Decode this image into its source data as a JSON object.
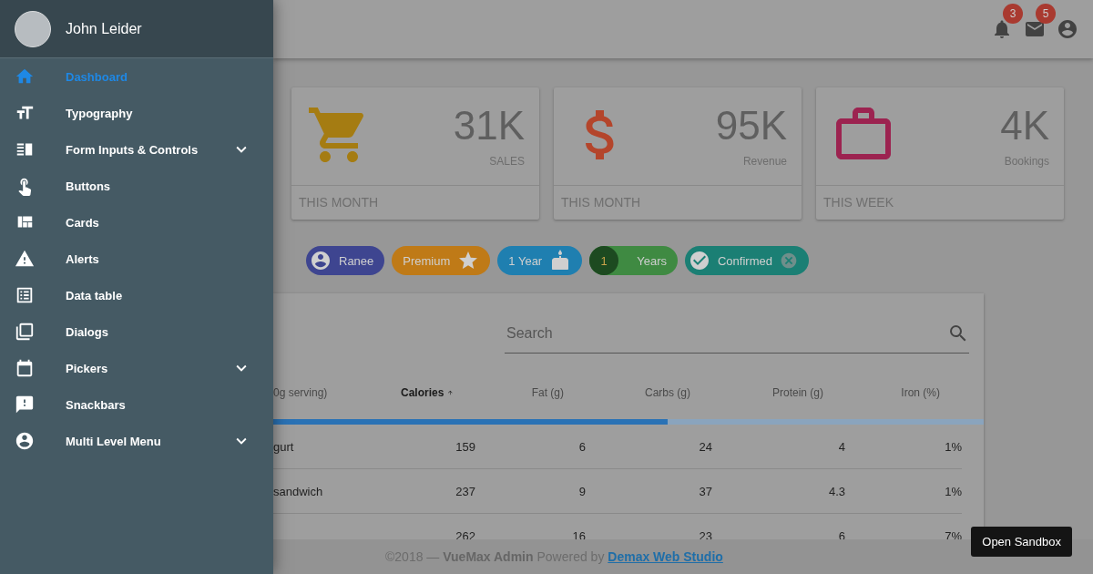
{
  "drawer": {
    "user": {
      "name": "John Leider"
    },
    "items": [
      {
        "label": "Dashboard",
        "selected": true,
        "expandable": false
      },
      {
        "label": "Typography",
        "selected": false,
        "expandable": false
      },
      {
        "label": "Form Inputs & Controls",
        "selected": false,
        "expandable": true
      },
      {
        "label": "Buttons",
        "selected": false,
        "expandable": false
      },
      {
        "label": "Cards",
        "selected": false,
        "expandable": false
      },
      {
        "label": "Alerts",
        "selected": false,
        "expandable": false
      },
      {
        "label": "Data table",
        "selected": false,
        "expandable": false
      },
      {
        "label": "Dialogs",
        "selected": false,
        "expandable": false
      },
      {
        "label": "Pickers",
        "selected": false,
        "expandable": true
      },
      {
        "label": "Snackbars",
        "selected": false,
        "expandable": false
      },
      {
        "label": "Multi Level Menu",
        "selected": false,
        "expandable": true
      }
    ]
  },
  "toolbar": {
    "notifications_badge": "3",
    "mail_badge": "5"
  },
  "stat_cards": [
    {
      "value": "31K",
      "label": "SALES",
      "footer": "THIS MONTH",
      "color": "#a57c12"
    },
    {
      "value": "95K",
      "label": "Revenue",
      "footer": "THIS MONTH",
      "color": "#b4452b"
    },
    {
      "value": "4K",
      "label": "Bookings",
      "footer": "THIS WEEK",
      "color": "#9c2350"
    }
  ],
  "chips": [
    {
      "label": "Ranee",
      "color": "#3e4590",
      "kind": "leading-icon"
    },
    {
      "label": "Premium",
      "color": "#bf7a17",
      "kind": "trailing-icon"
    },
    {
      "label": "1 Year",
      "color": "#1f7fb0",
      "kind": "trailing-icon"
    },
    {
      "label": "Years",
      "avatar": "1",
      "color": "#3f8a42",
      "kind": "avatar-text"
    },
    {
      "label": "Confirmed",
      "color": "#1b7f74",
      "kind": "closable"
    }
  ],
  "table": {
    "search": {
      "placeholder": "Search"
    },
    "columns": [
      {
        "label": "0g serving)",
        "sorted": false
      },
      {
        "label": "Calories",
        "sorted": true
      },
      {
        "label": "Fat (g)",
        "sorted": false
      },
      {
        "label": "Carbs (g)",
        "sorted": false
      },
      {
        "label": "Protein (g)",
        "sorted": false
      },
      {
        "label": "Iron (%)",
        "sorted": false
      }
    ],
    "progress": {
      "level": 0.555
    },
    "rows": [
      [
        "gurt",
        "159",
        "6",
        "24",
        "4",
        "1%"
      ],
      [
        "sandwich",
        "237",
        "9",
        "37",
        "4.3",
        "1%"
      ],
      [
        "",
        "262",
        "16",
        "23",
        "6",
        "7%"
      ]
    ]
  },
  "footer": {
    "text": "©2018 — **VueMax Admin** Powered by",
    "link": "Demax Web Studio"
  },
  "sandbox_button": "Open Sandbox"
}
